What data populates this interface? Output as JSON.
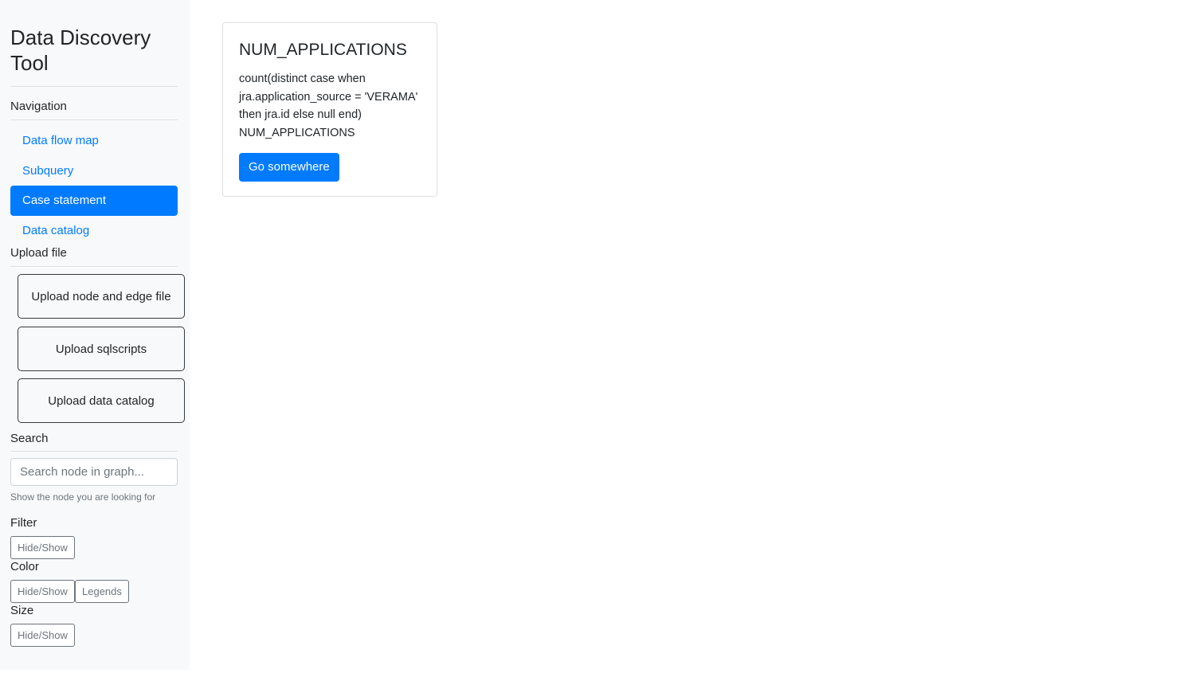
{
  "sidebar": {
    "title": "Data Discovery Tool",
    "navigation": {
      "heading": "Navigation",
      "items": [
        {
          "label": "Data flow map"
        },
        {
          "label": "Subquery"
        },
        {
          "label": "Case statement"
        },
        {
          "label": "Data catalog"
        }
      ]
    },
    "upload": {
      "heading": "Upload file",
      "items": [
        {
          "label": "Upload node and edge file"
        },
        {
          "label": "Upload sqlscripts"
        },
        {
          "label": "Upload data catalog"
        }
      ]
    },
    "search": {
      "heading": "Search",
      "placeholder": "Search node in graph...",
      "help": "Show the node you are looking for"
    },
    "filter": {
      "heading": "Filter",
      "toggle_label": "Hide/Show"
    },
    "color": {
      "heading": "Color",
      "toggle_label": "Hide/Show",
      "legends_label": "Legends"
    },
    "size": {
      "heading": "Size",
      "toggle_label": "Hide/Show"
    }
  },
  "card": {
    "title": "NUM_APPLICATIONS",
    "text": "count(distinct case when jra.application_source = 'VERAMA' then jra.id else null end) NUM_APPLICATIONS",
    "button_label": "Go somewhere"
  },
  "colors": {
    "accent": "#007bff",
    "sidebar_bg": "#f8f9fa"
  }
}
